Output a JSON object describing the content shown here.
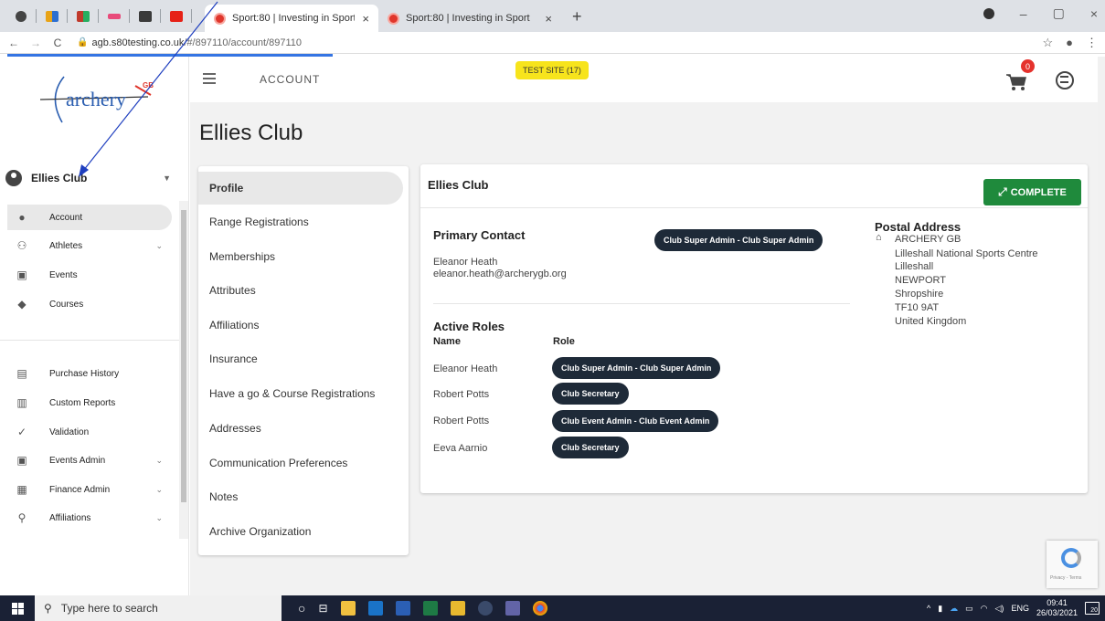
{
  "browser": {
    "tabs": [
      {
        "title": "Sport:80 | Investing in Sport",
        "close": "×"
      },
      {
        "title": "Sport:80 | Investing in Sport",
        "close": "×"
      }
    ],
    "new_tab": "+",
    "url_host": "agb.s80testing.co.uk",
    "url_path": "/#/897110/account/897110",
    "window_controls": [
      "–",
      "▢",
      "×"
    ]
  },
  "sidebar": {
    "logo_text": "archery",
    "logo_sup": "GB",
    "club_name": "Ellies Club",
    "menu": [
      {
        "label": "Account",
        "icon": "person-icon",
        "active": true
      },
      {
        "label": "Athletes",
        "icon": "group-icon",
        "chevron": "⌄"
      },
      {
        "label": "Events",
        "icon": "calendar-icon"
      },
      {
        "label": "Courses",
        "icon": "school-icon"
      },
      {
        "label": "Purchase History",
        "icon": "history-icon"
      },
      {
        "label": "Custom Reports",
        "icon": "reports-icon"
      },
      {
        "label": "Validation",
        "icon": "check-circle-icon"
      },
      {
        "label": "Events Admin",
        "icon": "event-admin-icon",
        "chevron": "⌄"
      },
      {
        "label": "Finance Admin",
        "icon": "finance-icon",
        "chevron": "⌄"
      },
      {
        "label": "Affiliations",
        "icon": "affiliation-icon",
        "chevron": "⌄"
      }
    ]
  },
  "header": {
    "title": "ACCOUNT",
    "test_site": "TEST SITE (17)",
    "cart_count": "0"
  },
  "main": {
    "page_title": "Ellies Club",
    "subnav": [
      "Profile",
      "Range Registrations",
      "Memberships",
      "Attributes",
      "Affiliations",
      "Insurance",
      "Have a go & Course Registrations",
      "Addresses",
      "Communication Preferences",
      "Notes",
      "Archive Organization"
    ],
    "card": {
      "title": "Ellies Club",
      "complete_label": "COMPLETE",
      "primary_contact_heading": "Primary Contact",
      "primary_contact_role": "Club Super Admin - Club Super Admin",
      "primary_contact_name": "Eleanor Heath",
      "primary_contact_email": "eleanor.heath@archerygb.org",
      "active_roles_heading": "Active Roles",
      "col_name": "Name",
      "col_role": "Role",
      "roles": [
        {
          "name": "Eleanor Heath",
          "role": "Club Super Admin - Club Super Admin"
        },
        {
          "name": "Robert Potts",
          "role": "Club Secretary"
        },
        {
          "name": "Robert Potts",
          "role": "Club Event Admin - Club Event Admin"
        },
        {
          "name": "Eeva Aarnio",
          "role": "Club Secretary"
        }
      ],
      "postal_heading": "Postal Address",
      "postal_lines": [
        "ARCHERY GB",
        "Lilleshall National Sports Centre",
        "Lilleshall",
        "NEWPORT",
        "Shropshire",
        "TF10 9AT",
        "United Kingdom"
      ]
    }
  },
  "recaptcha": {
    "text": "Privacy - Terms"
  },
  "taskbar": {
    "search_placeholder": "Type here to search",
    "lang": "ENG",
    "time": "09:41",
    "date": "26/03/2021",
    "notifications": "20"
  },
  "colors": {
    "complete_green": "#1f8a3c",
    "pill_dark": "#1e2a38",
    "test_site_yellow": "#f7e41c",
    "cart_badge_red": "#e5322d"
  }
}
